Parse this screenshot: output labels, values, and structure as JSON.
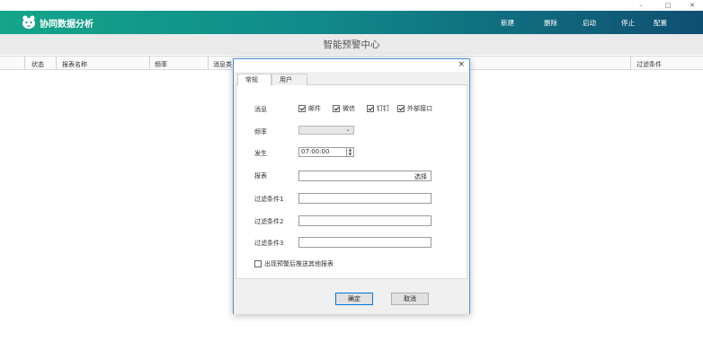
{
  "window": {
    "min": "–",
    "max": "□",
    "close": "✕"
  },
  "header": {
    "title": "协同数据分析",
    "nav": [
      "新建",
      "删除",
      "启动",
      "停止",
      "配置"
    ]
  },
  "page": {
    "title": "智能预警中心"
  },
  "list": {
    "columns": [
      "状态",
      "报表名称",
      "频率",
      "消息类",
      "过滤条件"
    ]
  },
  "dialog": {
    "close": "×",
    "tabs": [
      "常规",
      "用户"
    ],
    "message_label": "消息",
    "channels": [
      {
        "label": "邮件",
        "checked": true
      },
      {
        "label": "微信",
        "checked": true
      },
      {
        "label": "钉钉",
        "checked": true
      },
      {
        "label": "外部接口",
        "checked": true
      }
    ],
    "frequency_label": "频率",
    "frequency_value": "",
    "occur_label": "发生",
    "occur_value": "07:00:00",
    "report_label": "报表",
    "report_pick": "选择",
    "filter1_label": "过滤条件1",
    "filter2_label": "过滤条件2",
    "filter3_label": "过滤条件3",
    "push_other_label": "出现预警后推送其他报表",
    "push_other_checked": false,
    "ok": "确定",
    "cancel": "取消"
  },
  "colors": {
    "header_start": "#14a58a",
    "header_end": "#0f4f72",
    "dialog_border": "#4a90d9"
  }
}
